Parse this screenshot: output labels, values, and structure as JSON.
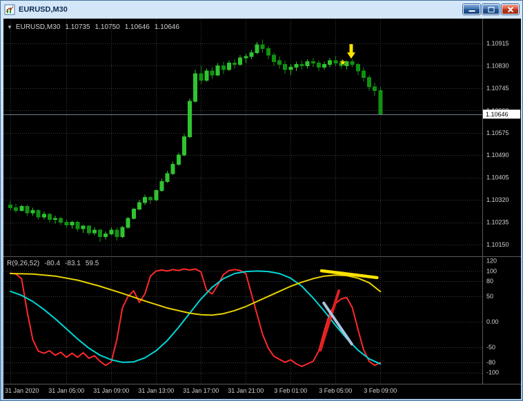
{
  "window": {
    "title": "EURUSD,M30",
    "buttons": [
      "minimize",
      "restore",
      "close"
    ]
  },
  "header": {
    "expander": "▼",
    "symbol": "EURUSD,M30",
    "open": "1.10735",
    "high": "1.10750",
    "low": "1.10646",
    "close": "1.10646"
  },
  "price_axis": {
    "labels": [
      {
        "text": "1.10915",
        "value": 1.10915
      },
      {
        "text": "1.10830",
        "value": 1.1083
      },
      {
        "text": "1.10745",
        "value": 1.10745
      },
      {
        "text": "1.10660",
        "value": 1.1066
      },
      {
        "text": "1.10575",
        "value": 1.10575
      },
      {
        "text": "1.10490",
        "value": 1.1049
      },
      {
        "text": "1.10405",
        "value": 1.10405
      },
      {
        "text": "1.10320",
        "value": 1.1032
      },
      {
        "text": "1.10235",
        "value": 1.10235
      },
      {
        "text": "1.10150",
        "value": 1.1015
      }
    ],
    "bid_tag": "1.10646"
  },
  "time_axis": {
    "ticks": [
      {
        "index": 0,
        "label": "31 Jan 2020"
      },
      {
        "index": 10,
        "label": "31 Jan 05:00"
      },
      {
        "index": 18,
        "label": "31 Jan 09:00"
      },
      {
        "index": 26,
        "label": "31 Jan 13:00"
      },
      {
        "index": 34,
        "label": "31 Jan 17:00"
      },
      {
        "index": 42,
        "label": "31 Jan 21:00"
      },
      {
        "index": 50,
        "label": "3 Feb 01:00"
      },
      {
        "index": 58,
        "label": "3 Feb 05:00"
      },
      {
        "index": 66,
        "label": "3 Feb 09:00"
      }
    ]
  },
  "indicator_panel": {
    "label": "R(9,26,52)",
    "values": [
      "-80.4",
      "-83.1",
      "59.5"
    ],
    "scale": [
      {
        "label": "120",
        "value": 120
      },
      {
        "label": "100",
        "value": 100
      },
      {
        "label": "80",
        "value": 80
      },
      {
        "label": "50",
        "value": 50
      },
      {
        "label": "0.00",
        "value": 0
      },
      {
        "label": "-50",
        "value": -50
      },
      {
        "label": "-80",
        "value": -80
      },
      {
        "label": "-100",
        "value": -100
      }
    ],
    "level_lines": [
      100,
      80,
      50,
      0,
      -50,
      -80,
      -100
    ]
  },
  "colors": {
    "bull": "#30C430",
    "bear": "#119111",
    "grid": "#3E3E3E",
    "axis_text": "#D4D4D4",
    "separator": "#5A5A5A",
    "bid_line": "#708090",
    "bid_tag_bg": "#FFFFFF",
    "bid_tag_text": "#000000",
    "red_line": "#FF2A2A",
    "cyan_line": "#00D8D8",
    "yellow_line": "#E8D400",
    "object_yellow": "#FFE400",
    "object_red": "#E02020",
    "object_steel": "#A8C4DE"
  },
  "chart_data": {
    "type": "candlestick",
    "symbol": "EURUSD",
    "timeframe": "M30",
    "bid": 1.10646,
    "candles": [
      [
        1.103,
        1.10315,
        1.1028,
        1.1029
      ],
      [
        1.1029,
        1.10305,
        1.1027,
        1.1028
      ],
      [
        1.1028,
        1.103,
        1.10275,
        1.10295
      ],
      [
        1.10295,
        1.103,
        1.1026,
        1.1027
      ],
      [
        1.1027,
        1.1029,
        1.1026,
        1.1028
      ],
      [
        1.1028,
        1.10285,
        1.10245,
        1.10255
      ],
      [
        1.10255,
        1.10275,
        1.10245,
        1.10265
      ],
      [
        1.10265,
        1.1027,
        1.10235,
        1.10245
      ],
      [
        1.10245,
        1.1026,
        1.1023,
        1.1025
      ],
      [
        1.1025,
        1.10255,
        1.10225,
        1.10235
      ],
      [
        1.10235,
        1.10245,
        1.10215,
        1.10225
      ],
      [
        1.10225,
        1.1024,
        1.1021,
        1.10235
      ],
      [
        1.10235,
        1.1024,
        1.102,
        1.1021
      ],
      [
        1.1021,
        1.10225,
        1.10195,
        1.1022
      ],
      [
        1.1022,
        1.10225,
        1.10185,
        1.10195
      ],
      [
        1.10195,
        1.10215,
        1.10185,
        1.10205
      ],
      [
        1.10205,
        1.1021,
        1.1016,
        1.1018
      ],
      [
        1.1018,
        1.102,
        1.1017,
        1.1019
      ],
      [
        1.1019,
        1.10215,
        1.10185,
        1.10205
      ],
      [
        1.10205,
        1.10215,
        1.10165,
        1.1018
      ],
      [
        1.1018,
        1.1022,
        1.10175,
        1.10215
      ],
      [
        1.10215,
        1.10255,
        1.1021,
        1.1025
      ],
      [
        1.1025,
        1.1029,
        1.10245,
        1.10285
      ],
      [
        1.10285,
        1.1032,
        1.1028,
        1.1031
      ],
      [
        1.1031,
        1.1034,
        1.103,
        1.1033
      ],
      [
        1.1033,
        1.10335,
        1.10305,
        1.1032
      ],
      [
        1.1032,
        1.1036,
        1.10315,
        1.10355
      ],
      [
        1.10355,
        1.104,
        1.1035,
        1.1039
      ],
      [
        1.1039,
        1.1043,
        1.10385,
        1.1042
      ],
      [
        1.1042,
        1.10465,
        1.10415,
        1.10455
      ],
      [
        1.10455,
        1.105,
        1.1045,
        1.1049
      ],
      [
        1.1049,
        1.1057,
        1.10485,
        1.1056
      ],
      [
        1.1056,
        1.10705,
        1.10555,
        1.10695
      ],
      [
        1.10695,
        1.10815,
        1.1069,
        1.108
      ],
      [
        1.108,
        1.1083,
        1.1076,
        1.10775
      ],
      [
        1.10775,
        1.1082,
        1.1077,
        1.1081
      ],
      [
        1.1081,
        1.10825,
        1.1078,
        1.10795
      ],
      [
        1.10795,
        1.1084,
        1.1079,
        1.1083
      ],
      [
        1.1083,
        1.10845,
        1.108,
        1.10815
      ],
      [
        1.10815,
        1.1085,
        1.1081,
        1.1084
      ],
      [
        1.1084,
        1.10855,
        1.1082,
        1.10835
      ],
      [
        1.10835,
        1.1087,
        1.1083,
        1.1086
      ],
      [
        1.1086,
        1.10875,
        1.1084,
        1.10865
      ],
      [
        1.10865,
        1.1089,
        1.10855,
        1.1088
      ],
      [
        1.1088,
        1.1092,
        1.10875,
        1.1091
      ],
      [
        1.1091,
        1.1093,
        1.1088,
        1.10895
      ],
      [
        1.10895,
        1.10905,
        1.10855,
        1.1087
      ],
      [
        1.1087,
        1.1088,
        1.1083,
        1.10845
      ],
      [
        1.1085,
        1.10865,
        1.1082,
        1.10835
      ],
      [
        1.10835,
        1.1085,
        1.108,
        1.10815
      ],
      [
        1.10815,
        1.10835,
        1.10795,
        1.10825
      ],
      [
        1.10825,
        1.10845,
        1.1081,
        1.10835
      ],
      [
        1.10835,
        1.1085,
        1.10815,
        1.1083
      ],
      [
        1.1083,
        1.10855,
        1.1082,
        1.10845
      ],
      [
        1.10845,
        1.1086,
        1.10825,
        1.1084
      ],
      [
        1.1084,
        1.1085,
        1.1081,
        1.10825
      ],
      [
        1.10825,
        1.10845,
        1.10815,
        1.10835
      ],
      [
        1.10835,
        1.1086,
        1.10825,
        1.1085
      ],
      [
        1.1085,
        1.10865,
        1.1083,
        1.1084
      ],
      [
        1.1084,
        1.10855,
        1.1082,
        1.1083
      ],
      [
        1.1083,
        1.1085,
        1.10815,
        1.10845
      ],
      [
        1.10845,
        1.10855,
        1.10825,
        1.10835
      ],
      [
        1.10835,
        1.1084,
        1.10795,
        1.1081
      ],
      [
        1.1081,
        1.10825,
        1.1077,
        1.10785
      ],
      [
        1.10785,
        1.10795,
        1.10735,
        1.1075
      ],
      [
        1.1075,
        1.10765,
        1.10715,
        1.10735
      ],
      [
        1.10735,
        1.1075,
        1.10646,
        1.10646
      ]
    ],
    "annotations": [
      {
        "type": "arrow-down",
        "index": 60.8,
        "price": 1.10857,
        "color": "#FFE400"
      },
      {
        "type": "star",
        "index": 59.3,
        "price": 1.10843,
        "color": "#FFE400",
        "glyph": "★"
      }
    ],
    "indicator": {
      "name": "R(9,26,52)",
      "current_values": [
        -80.4,
        -83.1,
        59.5
      ],
      "range": [
        -100,
        120
      ],
      "series": [
        {
          "name": "red",
          "color": "#FF2A2A",
          "points": [
            [
              0,
              96
            ],
            [
              1,
              94
            ],
            [
              2,
              85
            ],
            [
              3,
              20
            ],
            [
              4,
              -35
            ],
            [
              5,
              -58
            ],
            [
              6,
              -62
            ],
            [
              7,
              -57
            ],
            [
              8,
              -66
            ],
            [
              9,
              -60
            ],
            [
              10,
              -70
            ],
            [
              11,
              -62
            ],
            [
              12,
              -70
            ],
            [
              13,
              -61
            ],
            [
              14,
              -72
            ],
            [
              15,
              -67
            ],
            [
              16,
              -78
            ],
            [
              17,
              -86
            ],
            [
              18,
              -79
            ],
            [
              19,
              -35
            ],
            [
              20,
              28
            ],
            [
              21,
              50
            ],
            [
              22,
              61
            ],
            [
              23,
              38
            ],
            [
              24,
              55
            ],
            [
              25,
              90
            ],
            [
              26,
              100
            ],
            [
              27,
              102
            ],
            [
              28,
              100
            ],
            [
              29,
              103
            ],
            [
              30,
              101
            ],
            [
              31,
              104
            ],
            [
              32,
              102
            ],
            [
              33,
              104
            ],
            [
              34,
              98
            ],
            [
              35,
              62
            ],
            [
              36,
              55
            ],
            [
              37,
              72
            ],
            [
              38,
              93
            ],
            [
              39,
              101
            ],
            [
              40,
              103
            ],
            [
              41,
              101
            ],
            [
              42,
              95
            ],
            [
              43,
              55
            ],
            [
              44,
              15
            ],
            [
              45,
              -25
            ],
            [
              46,
              -52
            ],
            [
              47,
              -68
            ],
            [
              48,
              -74
            ],
            [
              49,
              -80
            ],
            [
              50,
              -75
            ],
            [
              51,
              -83
            ],
            [
              52,
              -88
            ],
            [
              53,
              -83
            ],
            [
              54,
              -78
            ],
            [
              55,
              -58
            ],
            [
              56,
              -18
            ],
            [
              57,
              18
            ],
            [
              58,
              36
            ],
            [
              59,
              45
            ],
            [
              60,
              48
            ],
            [
              61,
              28
            ],
            [
              62,
              -15
            ],
            [
              63,
              -55
            ],
            [
              64,
              -78
            ],
            [
              65,
              -86
            ],
            [
              66,
              -80.4
            ]
          ]
        },
        {
          "name": "cyan",
          "color": "#00D8D8",
          "points": [
            [
              0,
              60
            ],
            [
              2,
              52
            ],
            [
              4,
              40
            ],
            [
              6,
              24
            ],
            [
              8,
              6
            ],
            [
              10,
              -14
            ],
            [
              12,
              -34
            ],
            [
              14,
              -52
            ],
            [
              16,
              -66
            ],
            [
              18,
              -75
            ],
            [
              20,
              -80
            ],
            [
              22,
              -79
            ],
            [
              24,
              -71
            ],
            [
              26,
              -57
            ],
            [
              28,
              -37
            ],
            [
              30,
              -11
            ],
            [
              32,
              17
            ],
            [
              34,
              45
            ],
            [
              36,
              68
            ],
            [
              38,
              85
            ],
            [
              40,
              95
            ],
            [
              42,
              99
            ],
            [
              44,
              100
            ],
            [
              46,
              99
            ],
            [
              48,
              95
            ],
            [
              50,
              86
            ],
            [
              52,
              70
            ],
            [
              54,
              47
            ],
            [
              56,
              21
            ],
            [
              58,
              -7
            ],
            [
              60,
              -33
            ],
            [
              62,
              -56
            ],
            [
              64,
              -73
            ],
            [
              66,
              -83.1
            ]
          ]
        },
        {
          "name": "yellow",
          "color": "#E8D400",
          "points": [
            [
              0,
              95
            ],
            [
              4,
              94
            ],
            [
              8,
              90
            ],
            [
              12,
              82
            ],
            [
              16,
              70
            ],
            [
              20,
              56
            ],
            [
              24,
              41
            ],
            [
              28,
              27
            ],
            [
              32,
              17
            ],
            [
              34,
              14
            ],
            [
              36,
              13
            ],
            [
              38,
              16
            ],
            [
              40,
              22
            ],
            [
              42,
              30
            ],
            [
              44,
              40
            ],
            [
              46,
              50
            ],
            [
              48,
              60
            ],
            [
              50,
              70
            ],
            [
              52,
              78
            ],
            [
              54,
              85
            ],
            [
              56,
              90
            ],
            [
              58,
              92
            ],
            [
              60,
              91
            ],
            [
              62,
              86
            ],
            [
              64,
              77
            ],
            [
              66,
              59.5
            ]
          ]
        }
      ],
      "objects": [
        {
          "type": "trendline",
          "color": "#FFE400",
          "width": 4.5,
          "from": [
            55.5,
            100.5
          ],
          "to": [
            65.4,
            87
          ]
        },
        {
          "type": "trendline",
          "color": "#E02020",
          "width": 4,
          "from": [
            55.3,
            -56
          ],
          "to": [
            58.6,
            61
          ]
        },
        {
          "type": "trendline",
          "color": "#A8C4DE",
          "width": 4,
          "from": [
            55.9,
            37
          ],
          "to": [
            60.9,
            -44
          ]
        }
      ]
    }
  }
}
